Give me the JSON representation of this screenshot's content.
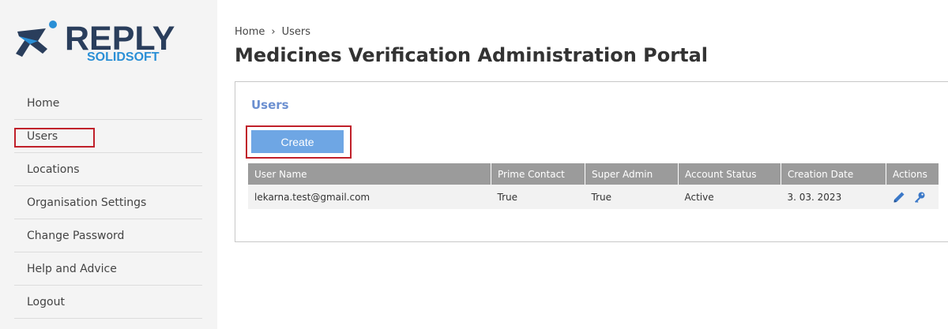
{
  "logo": {
    "word": "REPLY",
    "sub": "SOLIDSOFT"
  },
  "nav": {
    "items": [
      {
        "label": "Home"
      },
      {
        "label": "Users"
      },
      {
        "label": "Locations"
      },
      {
        "label": "Organisation Settings"
      },
      {
        "label": "Change Password"
      },
      {
        "label": "Help and Advice"
      },
      {
        "label": "Logout"
      }
    ]
  },
  "breadcrumb": {
    "home": "Home",
    "separator": "›",
    "current": "Users"
  },
  "page_title": "Medicines Verification Administration Portal",
  "panel": {
    "title": "Users",
    "create_label": "Create",
    "table": {
      "columns": [
        "User Name",
        "Prime Contact",
        "Super Admin",
        "Account Status",
        "Creation Date",
        "Actions"
      ],
      "rows": [
        {
          "user_name": "lekarna.test@gmail.com",
          "prime_contact": "True",
          "super_admin": "True",
          "account_status": "Active",
          "creation_date": "3. 03. 2023",
          "actions": [
            "pencil-icon",
            "key-icon"
          ]
        }
      ]
    }
  },
  "colors": {
    "accent": "#6ea6e4",
    "header_gray": "#9b9b9b",
    "highlight_red": "#c0202a",
    "panel_title": "#6b8fd0",
    "logo_navy": "#2a3e5c",
    "logo_blue": "#2a8fd6",
    "icon_blue": "#3a78c8"
  }
}
